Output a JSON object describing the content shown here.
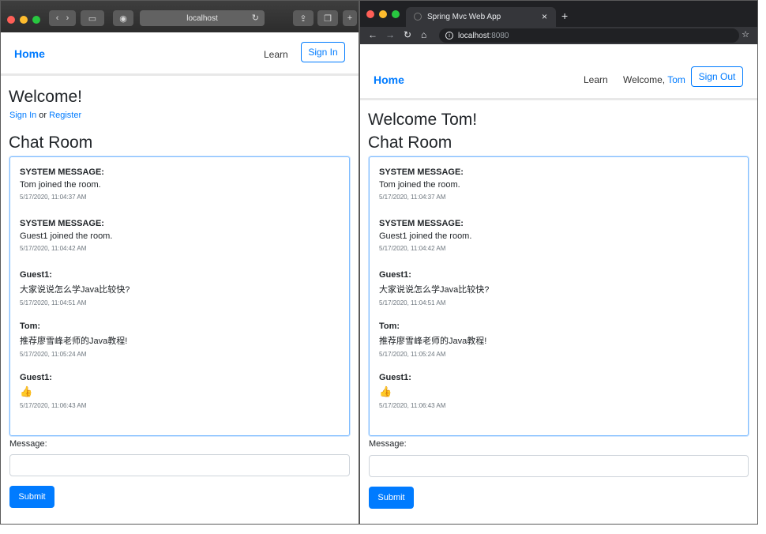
{
  "left_window": {
    "browser": {
      "address": "localhost",
      "traffic_colors": [
        "#ff5f57",
        "#febc2e",
        "#28c840"
      ]
    },
    "nav": {
      "brand": "Home",
      "learn": "Learn",
      "signin": "Sign In"
    },
    "welcome": "Welcome!",
    "signin_prompt": {
      "signin": "Sign In",
      "or": " or ",
      "register": "Register"
    },
    "chat_title": "Chat Room",
    "messages": [
      {
        "from": "SYSTEM MESSAGE",
        "text": "Tom joined the room.",
        "time": "5/17/2020, 11:04:37 AM"
      },
      {
        "from": "SYSTEM MESSAGE",
        "text": "Guest1 joined the room.",
        "time": "5/17/2020, 11:04:42 AM"
      },
      {
        "from": "Guest1",
        "text": "大家说说怎么学Java比较快?",
        "time": "5/17/2020, 11:04:51 AM"
      },
      {
        "from": "Tom",
        "text": "推荐廖雪峰老师的Java教程!",
        "time": "5/17/2020, 11:05:24 AM"
      },
      {
        "from": "Guest1",
        "text": "👍",
        "time": "5/17/2020, 11:06:43 AM"
      }
    ],
    "form": {
      "label": "Message:",
      "input_value": "",
      "submit": "Submit"
    }
  },
  "right_window": {
    "browser": {
      "tab_title": "Spring Mvc Web App",
      "address_host": "localhost",
      "address_port": ":8080",
      "traffic_colors": [
        "#ff5f57",
        "#febc2e",
        "#28c840"
      ]
    },
    "nav": {
      "brand": "Home",
      "learn": "Learn",
      "welcome_prefix": "Welcome, ",
      "username": "Tom",
      "signout": "Sign Out"
    },
    "welcome": "Welcome Tom!",
    "chat_title": "Chat Room",
    "messages": [
      {
        "from": "SYSTEM MESSAGE",
        "text": "Tom joined the room.",
        "time": "5/17/2020, 11:04:37 AM"
      },
      {
        "from": "SYSTEM MESSAGE",
        "text": "Guest1 joined the room.",
        "time": "5/17/2020, 11:04:42 AM"
      },
      {
        "from": "Guest1",
        "text": "大家说说怎么学Java比较快?",
        "time": "5/17/2020, 11:04:51 AM"
      },
      {
        "from": "Tom",
        "text": "推荐廖雪峰老师的Java教程!",
        "time": "5/17/2020, 11:05:24 AM"
      },
      {
        "from": "Guest1",
        "text": "👍",
        "time": "5/17/2020, 11:06:43 AM"
      }
    ],
    "form": {
      "label": "Message:",
      "input_value": "",
      "submit": "Submit"
    }
  },
  "colors": {
    "accent": "#007bff",
    "chat_border": "#80bdff"
  }
}
